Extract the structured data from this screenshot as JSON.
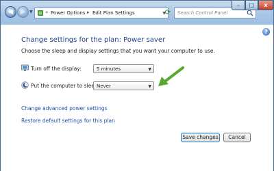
{
  "address_bar": {
    "breadcrumb": [
      "Power Options",
      "Edit Plan Settings"
    ],
    "separator": "▸",
    "overflow": "«"
  },
  "search": {
    "placeholder": "Search Control Panel"
  },
  "window_controls": {
    "minimize": "–",
    "maximize": "□",
    "close": "x"
  },
  "page": {
    "title": "Change settings for the plan: Power saver",
    "subtitle": "Choose the sleep and display settings that you want your computer to use."
  },
  "settings": [
    {
      "label": "Turn off the display:",
      "value": "5 minutes",
      "icon": "display-icon"
    },
    {
      "label": "Put the computer to sleep:",
      "value": "Never",
      "icon": "sleep-icon"
    }
  ],
  "links": {
    "advanced": "Change advanced power settings",
    "restore": "Restore default settings for this plan"
  },
  "buttons": {
    "save": "Save changes",
    "cancel": "Cancel"
  },
  "help": "?",
  "colors": {
    "title_blue": "#1e3f8c",
    "link_blue": "#1a50a8",
    "annotation_arrow": "#5aa832"
  }
}
